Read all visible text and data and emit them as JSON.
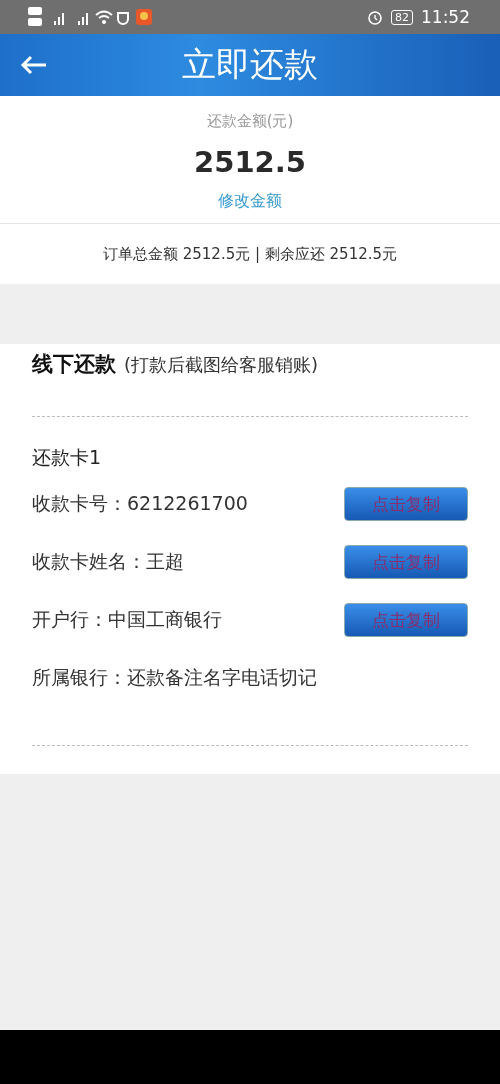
{
  "status_bar": {
    "battery": "82",
    "time": "11:52"
  },
  "header": {
    "title": "立即还款"
  },
  "amount": {
    "label": "还款金额(元)",
    "value": "2512.5",
    "edit_link": "修改金额"
  },
  "summary": "订单总金额 2512.5元 | 剩余应还 2512.5元",
  "offline": {
    "title": "线下还款",
    "note": "(打款后截图给客服销账)",
    "card_title": "还款卡1",
    "rows": [
      {
        "text": "收款卡号：6212261700",
        "copy_button": "点击复制"
      },
      {
        "text": "收款卡姓名：王超",
        "copy_button": "点击复制"
      },
      {
        "text": "开户行：中国工商银行",
        "copy_button": "点击复制"
      },
      {
        "text": "所属银行：还款备注名字电话切记"
      }
    ]
  }
}
